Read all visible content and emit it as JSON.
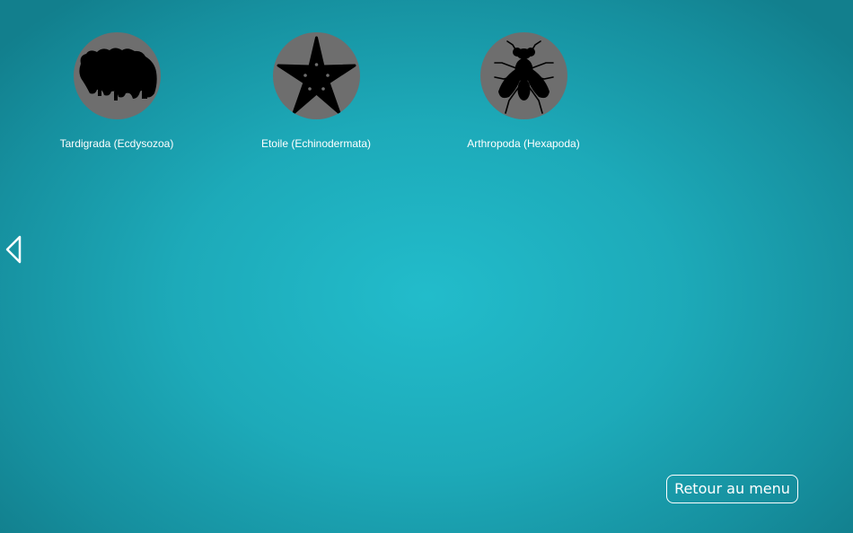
{
  "items": [
    {
      "label": "Tardigrada (Ecdysozoa)",
      "icon": "tardigrade-icon"
    },
    {
      "label": "Etoile (Echinodermata)",
      "icon": "starfish-icon"
    },
    {
      "label": "Arthropoda (Hexapoda)",
      "icon": "fly-icon"
    }
  ],
  "navigation": {
    "back_icon": "chevron-left-icon"
  },
  "footer": {
    "menu_button_label": "Retour au menu"
  },
  "colors": {
    "background": "#1daab9",
    "circle": "#6e6e6e",
    "silhouette": "#000000",
    "text": "#ffffff"
  }
}
